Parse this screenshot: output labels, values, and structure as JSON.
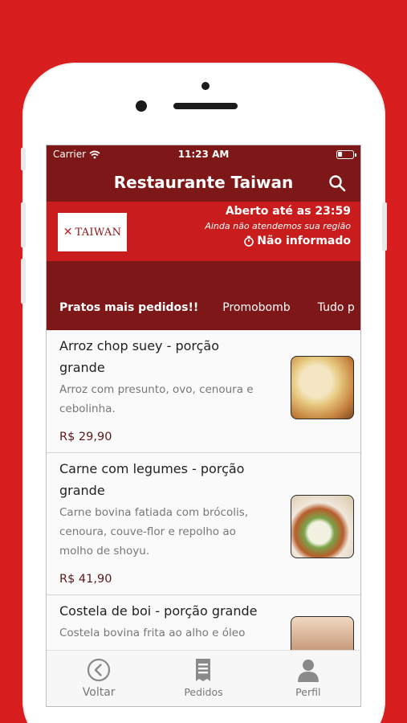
{
  "status_bar": {
    "carrier": "Carrier",
    "time": "11:23 AM"
  },
  "header": {
    "title": "Restaurante Taiwan"
  },
  "banner": {
    "logo_text": "TAIWAN",
    "open_until": "Aberto até as 23:59",
    "region_notice": "Ainda não atendemos sua região",
    "delivery_time": "Não informado"
  },
  "tabs": [
    {
      "label": "Pratos mais pedidos!!"
    },
    {
      "label": "Promobomb"
    },
    {
      "label": "Tudo p"
    }
  ],
  "items": [
    {
      "name": "Arroz chop suey - porção grande",
      "description": "Arroz com presunto, ovo, cenoura e cebolinha.",
      "price": "R$ 29,90"
    },
    {
      "name": "Carne com legumes - porção grande",
      "description": "Carne bovina fatiada com brócolis, cenoura, couve-flor e repolho ao molho de shoyu.",
      "price": "R$ 41,90"
    },
    {
      "name": "Costela de boi - porção grande",
      "description": "Costela bovina frita ao alho e óleo",
      "price": ""
    }
  ],
  "bottom_nav": [
    {
      "label": "Voltar",
      "icon": "chevron-left-circle-icon"
    },
    {
      "label": "Pedidos",
      "icon": "receipt-icon"
    },
    {
      "label": "Perfil",
      "icon": "user-icon"
    }
  ],
  "colors": {
    "background": "#d81e1e",
    "header": "#7e1818",
    "banner": "#c91d1d"
  }
}
